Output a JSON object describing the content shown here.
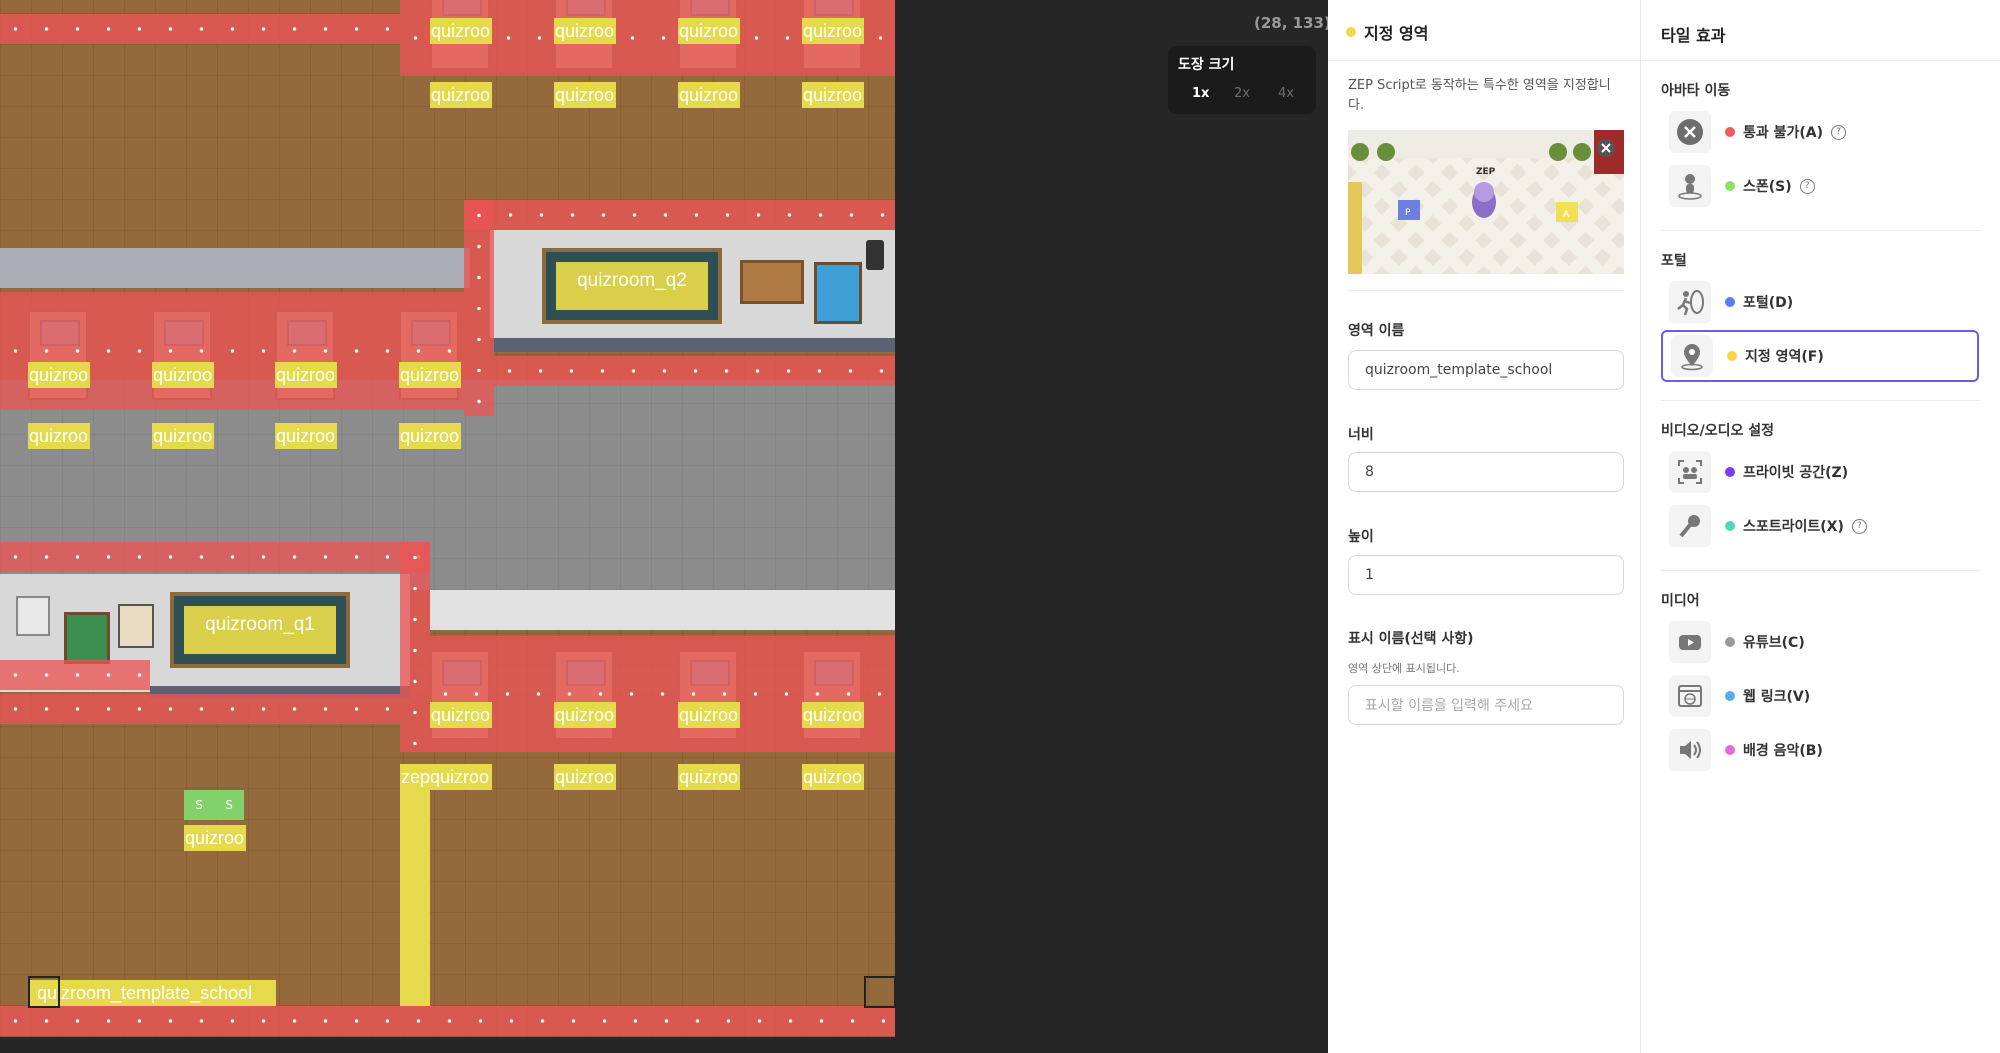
{
  "map": {
    "coordinate": "(28, 133)",
    "zoom": {
      "title": "도장 크기",
      "options": [
        "1x",
        "2x",
        "4x"
      ],
      "selected": "1x"
    },
    "area_labels": {
      "short": "quizroo",
      "zep_short": "zepquizroo",
      "q1": "quizroom_q1",
      "q2": "quizroom_q2",
      "template": "quizroom_template_school",
      "spawn": "S"
    }
  },
  "area_panel": {
    "title": "지정 영역",
    "dot_color": "#f5d84a",
    "description": "ZEP Script로 동작하는 특수한 영역을 지정합니다.",
    "preview": {
      "logo": "ZEP",
      "tile_p": "P",
      "tile_a": "A"
    },
    "fields": {
      "name_label": "영역 이름",
      "name_value": "quizroom_template_school",
      "width_label": "너비",
      "width_value": "8",
      "height_label": "높이",
      "height_value": "1",
      "display_label": "표시 이름(선택 사항)",
      "display_hint": "영역 상단에 표시됩니다.",
      "display_placeholder": "표시할 이름을 입력해 주세요"
    }
  },
  "tile_panel": {
    "title": "타일 효과",
    "sections": {
      "avatar": "아바타 이동",
      "portal": "포털",
      "av": "비디오/오디오 설정",
      "media": "미디어"
    },
    "items": {
      "impassable": {
        "label": "통과 불가(A)",
        "color": "#ef5a5a"
      },
      "spawn": {
        "label": "스폰(S)",
        "color": "#8ee06a"
      },
      "portal": {
        "label": "포털(D)",
        "color": "#5a7cf0"
      },
      "area": {
        "label": "지정 영역(F)",
        "color": "#f5d84a"
      },
      "private": {
        "label": "프라이빗 공간(Z)",
        "color": "#7b3cf0"
      },
      "spotlight": {
        "label": "스포트라이트(X)",
        "color": "#4fd8b8"
      },
      "youtube": {
        "label": "유튜브(C)",
        "color": "#9a9a9a"
      },
      "weblink": {
        "label": "웹 링크(V)",
        "color": "#5aa8f0"
      },
      "bgm": {
        "label": "배경 음악(B)",
        "color": "#e56ad8"
      }
    },
    "help": "?"
  }
}
